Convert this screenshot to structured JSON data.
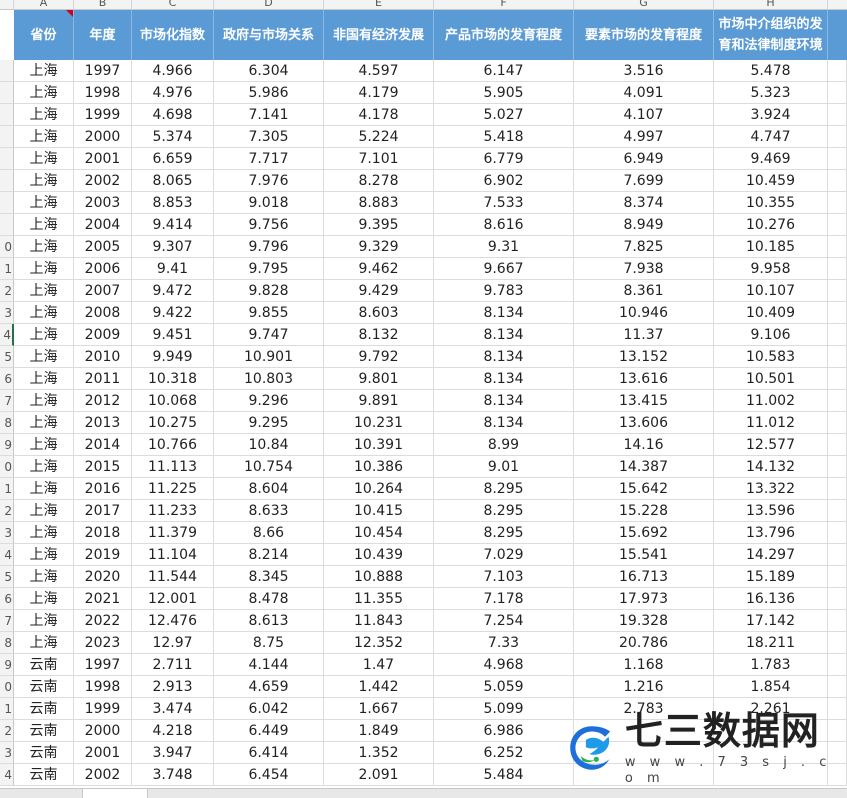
{
  "columns": [
    "A",
    "B",
    "C",
    "D",
    "E",
    "F",
    "G",
    "H"
  ],
  "headers": [
    "省份",
    "年度",
    "市场化指数",
    "政府与市场关系",
    "非国有经济发展",
    "产品市场的发育程度",
    "要素市场的发育程度",
    "市场中介组织的发育和法律制度环境"
  ],
  "row_numbers": [
    "",
    "",
    "",
    "",
    "",
    "",
    "",
    "",
    "0",
    "1",
    "2",
    "3",
    "4",
    "5",
    "6",
    "7",
    "8",
    "9",
    "0",
    "1",
    "2",
    "3",
    "4",
    "5",
    "6",
    "7",
    "8",
    "9",
    "0",
    "1",
    "2",
    "3",
    "4"
  ],
  "active_row_index": 12,
  "rows": [
    [
      "上海",
      "1997",
      "4.966",
      "6.304",
      "4.597",
      "6.147",
      "3.516",
      "5.478"
    ],
    [
      "上海",
      "1998",
      "4.976",
      "5.986",
      "4.179",
      "5.905",
      "4.091",
      "5.323"
    ],
    [
      "上海",
      "1999",
      "4.698",
      "7.141",
      "4.178",
      "5.027",
      "4.107",
      "3.924"
    ],
    [
      "上海",
      "2000",
      "5.374",
      "7.305",
      "5.224",
      "5.418",
      "4.997",
      "4.747"
    ],
    [
      "上海",
      "2001",
      "6.659",
      "7.717",
      "7.101",
      "6.779",
      "6.949",
      "9.469"
    ],
    [
      "上海",
      "2002",
      "8.065",
      "7.976",
      "8.278",
      "6.902",
      "7.699",
      "10.459"
    ],
    [
      "上海",
      "2003",
      "8.853",
      "9.018",
      "8.883",
      "7.533",
      "8.374",
      "10.355"
    ],
    [
      "上海",
      "2004",
      "9.414",
      "9.756",
      "9.395",
      "8.616",
      "8.949",
      "10.276"
    ],
    [
      "上海",
      "2005",
      "9.307",
      "9.796",
      "9.329",
      "9.31",
      "7.825",
      "10.185"
    ],
    [
      "上海",
      "2006",
      "9.41",
      "9.795",
      "9.462",
      "9.667",
      "7.938",
      "9.958"
    ],
    [
      "上海",
      "2007",
      "9.472",
      "9.828",
      "9.429",
      "9.783",
      "8.361",
      "10.107"
    ],
    [
      "上海",
      "2008",
      "9.422",
      "9.855",
      "8.603",
      "8.134",
      "10.946",
      "10.409"
    ],
    [
      "上海",
      "2009",
      "9.451",
      "9.747",
      "8.132",
      "8.134",
      "11.37",
      "9.106"
    ],
    [
      "上海",
      "2010",
      "9.949",
      "10.901",
      "9.792",
      "8.134",
      "13.152",
      "10.583"
    ],
    [
      "上海",
      "2011",
      "10.318",
      "10.803",
      "9.801",
      "8.134",
      "13.616",
      "10.501"
    ],
    [
      "上海",
      "2012",
      "10.068",
      "9.296",
      "9.891",
      "8.134",
      "13.415",
      "11.002"
    ],
    [
      "上海",
      "2013",
      "10.275",
      "9.295",
      "10.231",
      "8.134",
      "13.606",
      "11.012"
    ],
    [
      "上海",
      "2014",
      "10.766",
      "10.84",
      "10.391",
      "8.99",
      "14.16",
      "12.577"
    ],
    [
      "上海",
      "2015",
      "11.113",
      "10.754",
      "10.386",
      "9.01",
      "14.387",
      "14.132"
    ],
    [
      "上海",
      "2016",
      "11.225",
      "8.604",
      "10.264",
      "8.295",
      "15.642",
      "13.322"
    ],
    [
      "上海",
      "2017",
      "11.233",
      "8.633",
      "10.415",
      "8.295",
      "15.228",
      "13.596"
    ],
    [
      "上海",
      "2018",
      "11.379",
      "8.66",
      "10.454",
      "8.295",
      "15.692",
      "13.796"
    ],
    [
      "上海",
      "2019",
      "11.104",
      "8.214",
      "10.439",
      "7.029",
      "15.541",
      "14.297"
    ],
    [
      "上海",
      "2020",
      "11.544",
      "8.345",
      "10.888",
      "7.103",
      "16.713",
      "15.189"
    ],
    [
      "上海",
      "2021",
      "12.001",
      "8.478",
      "11.355",
      "7.178",
      "17.973",
      "16.136"
    ],
    [
      "上海",
      "2022",
      "12.476",
      "8.613",
      "11.843",
      "7.254",
      "19.328",
      "17.142"
    ],
    [
      "上海",
      "2023",
      "12.97",
      "8.75",
      "12.352",
      "7.33",
      "20.786",
      "18.211"
    ],
    [
      "云南",
      "1997",
      "2.711",
      "4.144",
      "1.47",
      "4.968",
      "1.168",
      "1.783"
    ],
    [
      "云南",
      "1998",
      "2.913",
      "4.659",
      "1.442",
      "5.059",
      "1.216",
      "1.854"
    ],
    [
      "云南",
      "1999",
      "3.474",
      "6.042",
      "1.667",
      "5.099",
      "2.783",
      "2.261"
    ],
    [
      "云南",
      "2000",
      "4.218",
      "6.449",
      "1.849",
      "6.986",
      "",
      ""
    ],
    [
      "云南",
      "2001",
      "3.947",
      "6.414",
      "1.352",
      "6.252",
      "",
      ""
    ],
    [
      "云南",
      "2002",
      "3.748",
      "6.454",
      "2.091",
      "5.484",
      "",
      ""
    ]
  ],
  "watermark": {
    "name": "七三数据网",
    "url": "w w w . 7 3 s j . c o m"
  },
  "colors": {
    "header_bg": "#5b9bd5",
    "header_text": "#ffffff",
    "grid_line": "#dcdcdc",
    "logo_blue": "#1e6fd9",
    "logo_green": "#2bb24c"
  }
}
